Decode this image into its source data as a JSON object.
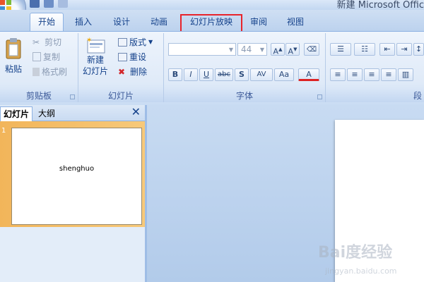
{
  "window": {
    "title": "新建 Microsoft Offic"
  },
  "tabs": [
    {
      "label": "开始",
      "active": true
    },
    {
      "label": "插入"
    },
    {
      "label": "设计"
    },
    {
      "label": "动画"
    },
    {
      "label": "幻灯片放映",
      "highlighted": true
    },
    {
      "label": "审阅"
    },
    {
      "label": "视图"
    }
  ],
  "ribbon": {
    "clipboard": {
      "label": "剪贴板",
      "paste": "粘贴",
      "cut": "剪切",
      "copy": "复制",
      "format_painter": "格式刷"
    },
    "slides": {
      "label": "幻灯片",
      "new_slide_line1": "新建",
      "new_slide_line2": "幻灯片",
      "layout": "版式",
      "reset": "重设",
      "delete": "删除"
    },
    "font": {
      "label": "字体",
      "font_size": "44",
      "bold": "B",
      "italic": "I",
      "underline": "U",
      "strike": "abc",
      "shadow": "S",
      "spacing": "AV",
      "case": "Aa",
      "color": "A"
    },
    "paragraph": {
      "label": "段"
    }
  },
  "pane": {
    "tab_slides": "幻灯片",
    "tab_outline": "大纲",
    "slide_number": "1",
    "thumbnail_text": "shenghuo"
  },
  "watermark": {
    "text": "Bai度经验",
    "url": "jingyan.baidu.com"
  }
}
